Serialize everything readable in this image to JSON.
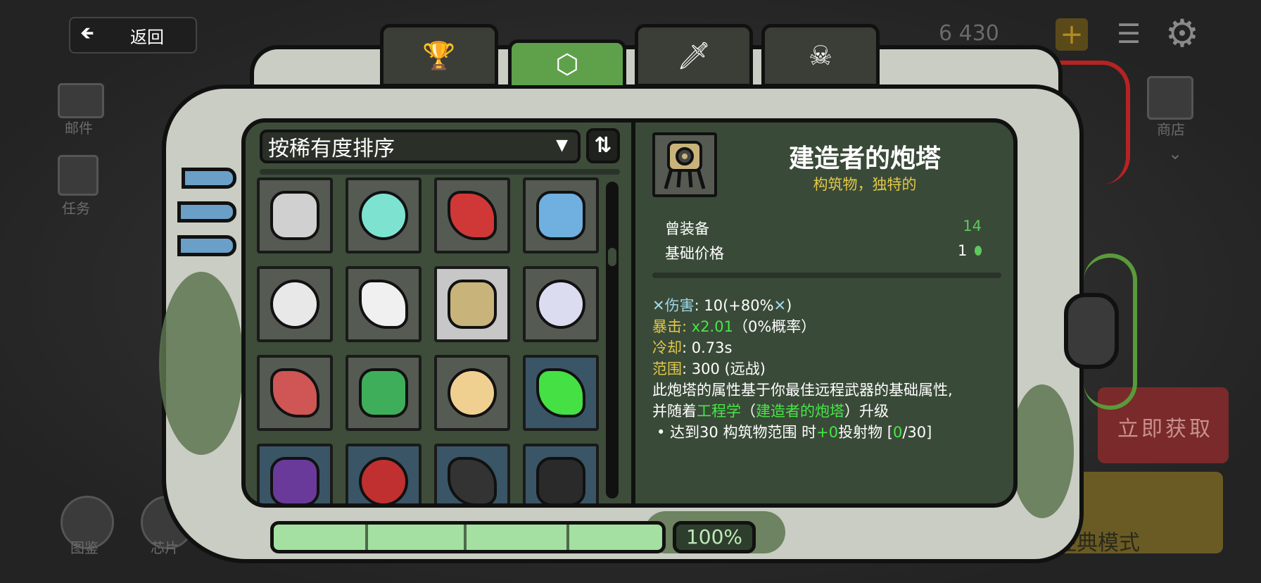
{
  "header": {
    "back_label": "返回",
    "currency": "6 430"
  },
  "background": {
    "mail": "邮件",
    "tasks": "任务",
    "shop": "商店",
    "codex": "图鉴",
    "chips": "芯片",
    "get_now": "立即获取",
    "classic_mode": "经典模式"
  },
  "tabs": [
    {
      "icon": "trophy-icon",
      "glyph": "🏆"
    },
    {
      "icon": "cube-icon",
      "glyph": "⬡"
    },
    {
      "icon": "sword-icon",
      "glyph": "🗡"
    },
    {
      "icon": "skull-icon",
      "glyph": "☠"
    }
  ],
  "sort": {
    "label": "按稀有度排序",
    "toggle": "⇅"
  },
  "items": [
    {
      "name": "rocket",
      "color": "#d0d0d0",
      "rare": false
    },
    {
      "name": "slime",
      "color": "#7de3d0",
      "rare": false
    },
    {
      "name": "whistle",
      "color": "#d03838",
      "rare": false
    },
    {
      "name": "fish",
      "color": "#6fb0e0",
      "rare": false
    },
    {
      "name": "penguin",
      "color": "#e8e8e8",
      "rare": false
    },
    {
      "name": "feather",
      "color": "#f0f0f0",
      "rare": false
    },
    {
      "name": "builder-turret",
      "color": "#c8b37a",
      "rare": false,
      "selected": true
    },
    {
      "name": "engine",
      "color": "#dcdcf0",
      "rare": false
    },
    {
      "name": "meat",
      "color": "#d05555",
      "rare": false
    },
    {
      "name": "egg",
      "color": "#3fae5a",
      "rare": false
    },
    {
      "name": "cheese",
      "color": "#f0d090",
      "rare": false
    },
    {
      "name": "potion",
      "color": "#44e044",
      "rare": true
    },
    {
      "name": "berries",
      "color": "#6a3a9a",
      "rare": true
    },
    {
      "name": "cloak",
      "color": "#c03030",
      "rare": true
    },
    {
      "name": "belt",
      "color": "#333333",
      "rare": true
    },
    {
      "name": "cloth",
      "color": "#2a2a2a",
      "rare": true
    }
  ],
  "detail": {
    "name": "建造者的炮塔",
    "subtitle": "构筑物，独特的",
    "equipped_label": "曾装备",
    "equipped_value": "14",
    "price_label": "基础价格",
    "price_value": "1",
    "damage_label": "伤害",
    "damage_value": ": 10(+80%",
    "damage_close": ")",
    "crit_label": "暴击:",
    "crit_value": "x2.01",
    "crit_chance": "（0%概率）",
    "cooldown_label": "冷却",
    "cooldown_value": ": 0.73s",
    "range_label": "范围",
    "range_value": ": 300 (远战)",
    "desc_line1": "此炮塔的属性基于你最佳远程武器的基础属性,",
    "desc_line2_a": "并随着",
    "desc_line2_b": "工程学",
    "desc_line2_c": "（",
    "desc_line2_d": "建造者的炮塔",
    "desc_line2_e": "）升级",
    "bullet_a": "• 达到30 构筑物范围 时",
    "bullet_b": "+0",
    "bullet_c": "投射物  [",
    "bullet_d": "0",
    "bullet_e": "/30]"
  },
  "progress": {
    "value": 1.0,
    "label": "100%"
  },
  "colors": {
    "accent_green": "#5fa14b",
    "highlight_green": "#47e647",
    "gold": "#e2c84a",
    "blue": "#9fd8e8"
  }
}
